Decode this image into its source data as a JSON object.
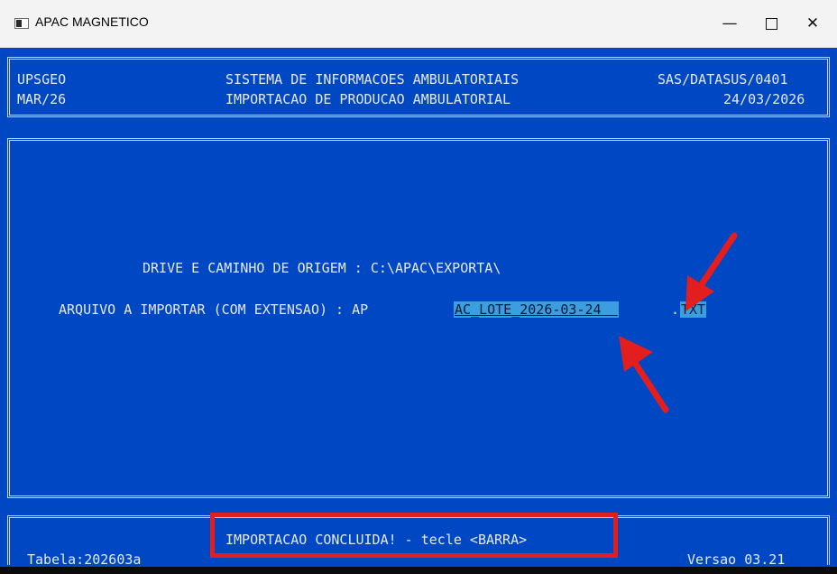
{
  "window": {
    "title": "APAC MAGNETICO",
    "controls": {
      "minimize": "—",
      "close": "✕"
    }
  },
  "header": {
    "left_line1": "UPSGEO",
    "left_line2": "MAR/26",
    "center_line1": "SISTEMA DE INFORMACOES AMBULATORIAIS",
    "center_line2": "IMPORTACAO DE PRODUCAO AMBULATORIAL",
    "right_line1": "SAS/DATASUS/0401",
    "right_line2": "24/03/2026"
  },
  "form": {
    "drive_label": "DRIVE E CAMINHO DE ORIGEM : C:\\APAC\\EXPORTA\\",
    "file_label": "ARQUIVO A IMPORTAR (COM EXTENSAO) : AP",
    "file_name_value": "AC_LOTE_2026-03-24  ",
    "file_ext_value": "TXT"
  },
  "footer": {
    "status": "IMPORTACAO CONCLUIDA! - tecle <BARRA>",
    "tabela": "Tabela:202603a",
    "versao": "Versao 03.21"
  },
  "annotations": {
    "highlight_color": "#e31e1e",
    "field_highlight_color": "#3b9ede",
    "console_color": "#0047c4"
  }
}
